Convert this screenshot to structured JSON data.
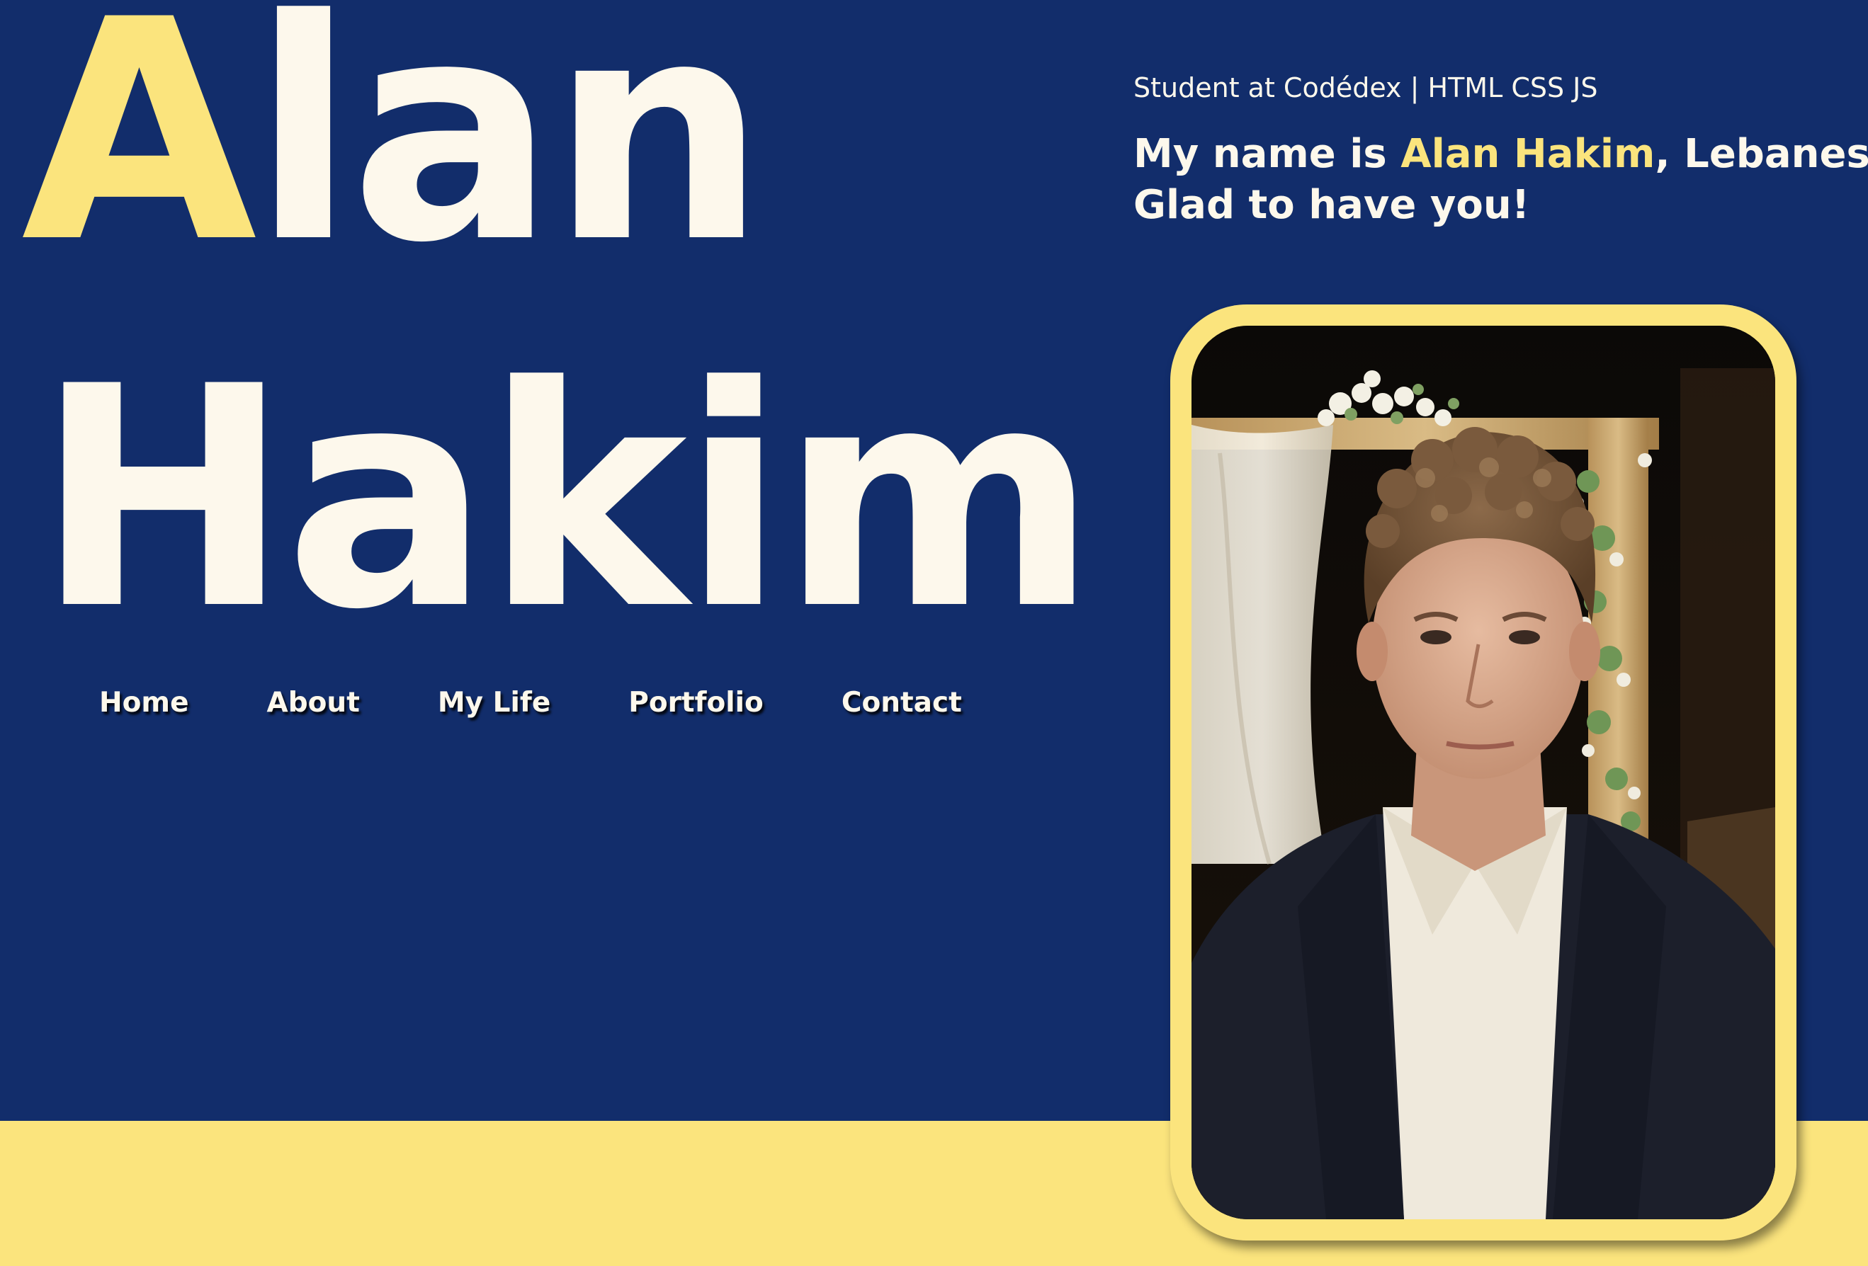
{
  "hero": {
    "first_initial": "A",
    "first_rest": "lan",
    "last_name": "Hakim"
  },
  "nav": {
    "items": [
      "Home",
      "About",
      "My Life",
      "Portfolio",
      "Contact"
    ]
  },
  "intro": {
    "subtitle": "Student at Codédex | HTML CSS JS",
    "bio_prefix": "My name is ",
    "bio_name": "Alan Hakim",
    "bio_suffix": ", Lebanese.",
    "bio_line2": "Glad to have you!"
  },
  "colors": {
    "background": "#122d6b",
    "accent": "#fbe47d",
    "text": "#fdf8ec"
  }
}
